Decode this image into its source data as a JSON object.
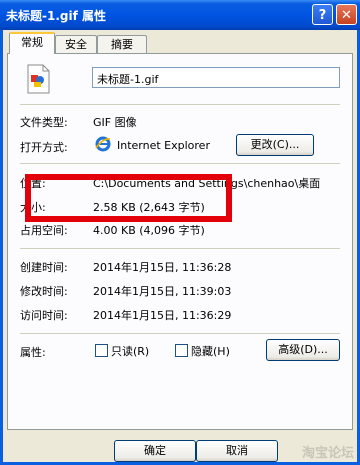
{
  "window": {
    "title": "未标题-1.gif 属性",
    "help_btn": "?",
    "close_btn": "✕"
  },
  "tabs": [
    "常规",
    "安全",
    "摘要"
  ],
  "file_name": "未标题-1.gif",
  "rows": {
    "type_label": "文件类型:",
    "type_value": "GIF 图像",
    "open_label": "打开方式:",
    "open_value": "Internet Explorer",
    "change_btn": "更改(C)...",
    "location_label": "位置:",
    "location_value": "C:\\Documents and Settings\\chenhao\\桌面",
    "size_label": "大小:",
    "size_value": "2.58 KB (2,643 字节)",
    "disk_label": "占用空间:",
    "disk_value": "4.00 KB (4,096 字节)",
    "created_label": "创建时间:",
    "created_value": "2014年1月15日, 11:36:28",
    "modified_label": "修改时间:",
    "modified_value": "2014年1月15日, 11:39:03",
    "accessed_label": "访问时间:",
    "accessed_value": "2014年1月15日, 11:36:29",
    "attr_label": "属性:",
    "readonly": "只读(R)",
    "hidden": "隐藏(H)",
    "advanced_btn": "高级(D)..."
  },
  "footer": {
    "ok": "确定",
    "cancel": "取消"
  },
  "watermark": "淘宝论坛"
}
